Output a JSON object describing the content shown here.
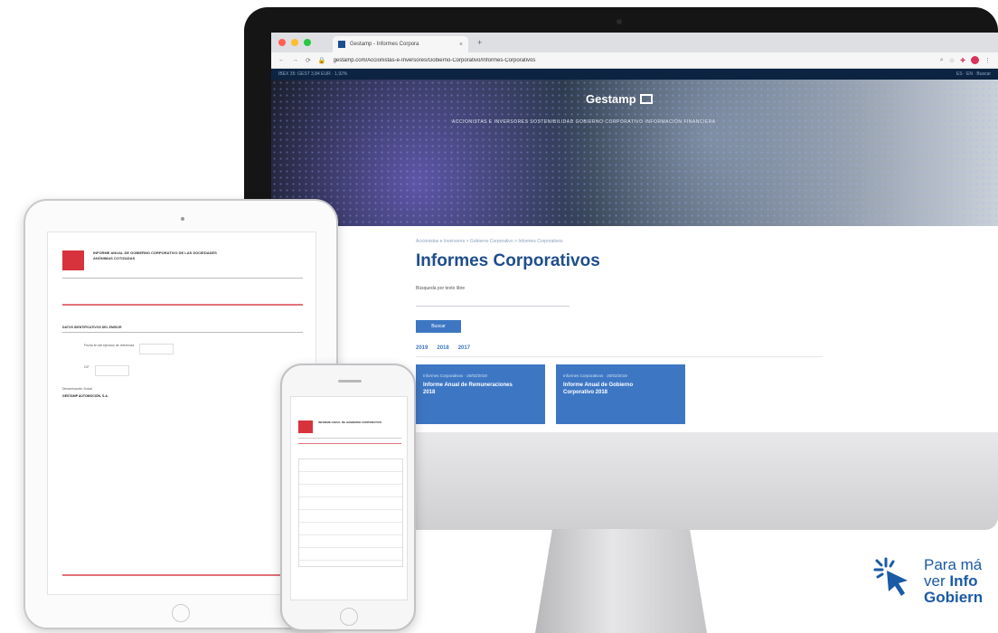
{
  "browser": {
    "tab_title": "Gestamp - Informes Corpora",
    "tab_close": "×",
    "new_tab": "+",
    "url": "gestamp.com/Accionistas-e-Inversores/Gobierno-Corporativo/Informes-Corporativos"
  },
  "site": {
    "topbar_left": "IBEX 35: GEST 3,84 EUR · 1,92%",
    "topbar_right": "ES · EN · Buscar",
    "brand": "Gestamp",
    "nav": "ACCIONISTAS E INVERSORES   SOSTENIBILIDAD   GOBIERNO CORPORATIVO   INFORMACIÓN FINANCIERA",
    "breadcrumb": "Accionistas e Inversores  >  Gobierno Corporativo  >  Informes Corporativos",
    "title": "Informes Corporativos",
    "search_label": "Búsqueda por texto libre",
    "search_button": "Buscar",
    "years": [
      "2019",
      "2018",
      "2017"
    ],
    "cards": [
      {
        "kicker": "Informes Corporativos · 20/02/2019",
        "title": "Informe Anual de Remuneraciones 2018"
      },
      {
        "kicker": "Informes Corporativos · 20/02/2019",
        "title": "Informe Anual de Gobierno Corporativo 2018"
      }
    ]
  },
  "tablet_doc": {
    "title": "INFORME ANUAL DE GOBIERNO CORPORATIVO DE LAS SOCIEDADES ANÓNIMAS COTIZADAS",
    "section": "DATOS IDENTIFICATIVOS DEL EMISOR",
    "field1_label": "Fecha fin del ejercicio de referencia",
    "field2_label": "CIF",
    "company_label": "Denominación Social",
    "company": "GESTAMP AUTOMOCIÓN, S.A."
  },
  "phone_doc": {
    "title": "INFORME ANUAL DE GOBIERNO CORPORATIVO"
  },
  "cta": {
    "line1": "Para má",
    "line2_prefix": "ver ",
    "line2_bold": "Info",
    "line3": "Gobiern"
  },
  "colors": {
    "brand_blue": "#1f4e8c",
    "accent_blue": "#3d77c4",
    "cta_blue": "#1a5aa6",
    "doc_red": "#d8323c"
  }
}
